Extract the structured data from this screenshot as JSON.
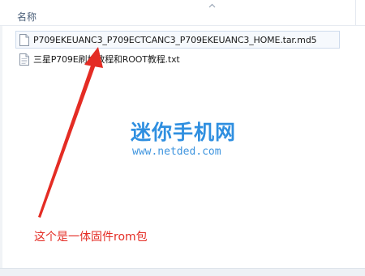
{
  "header": {
    "name_column": "名称",
    "sort_icon": "chevron-up-icon"
  },
  "files": [
    {
      "name": "P709EKEUANC3_P709ECTCANC3_P709EKEUANC3_HOME.tar.md5",
      "icon": "file-icon",
      "selected": true
    },
    {
      "name": "三星P709E刷机教程和ROOT教程.txt",
      "icon": "text-file-icon",
      "selected": false
    }
  ],
  "watermark": {
    "title": "迷你手机网",
    "url": "www.netded.com"
  },
  "annotation": {
    "caption": "这个是一体固件rom包",
    "arrow_color": "#e42c24"
  }
}
